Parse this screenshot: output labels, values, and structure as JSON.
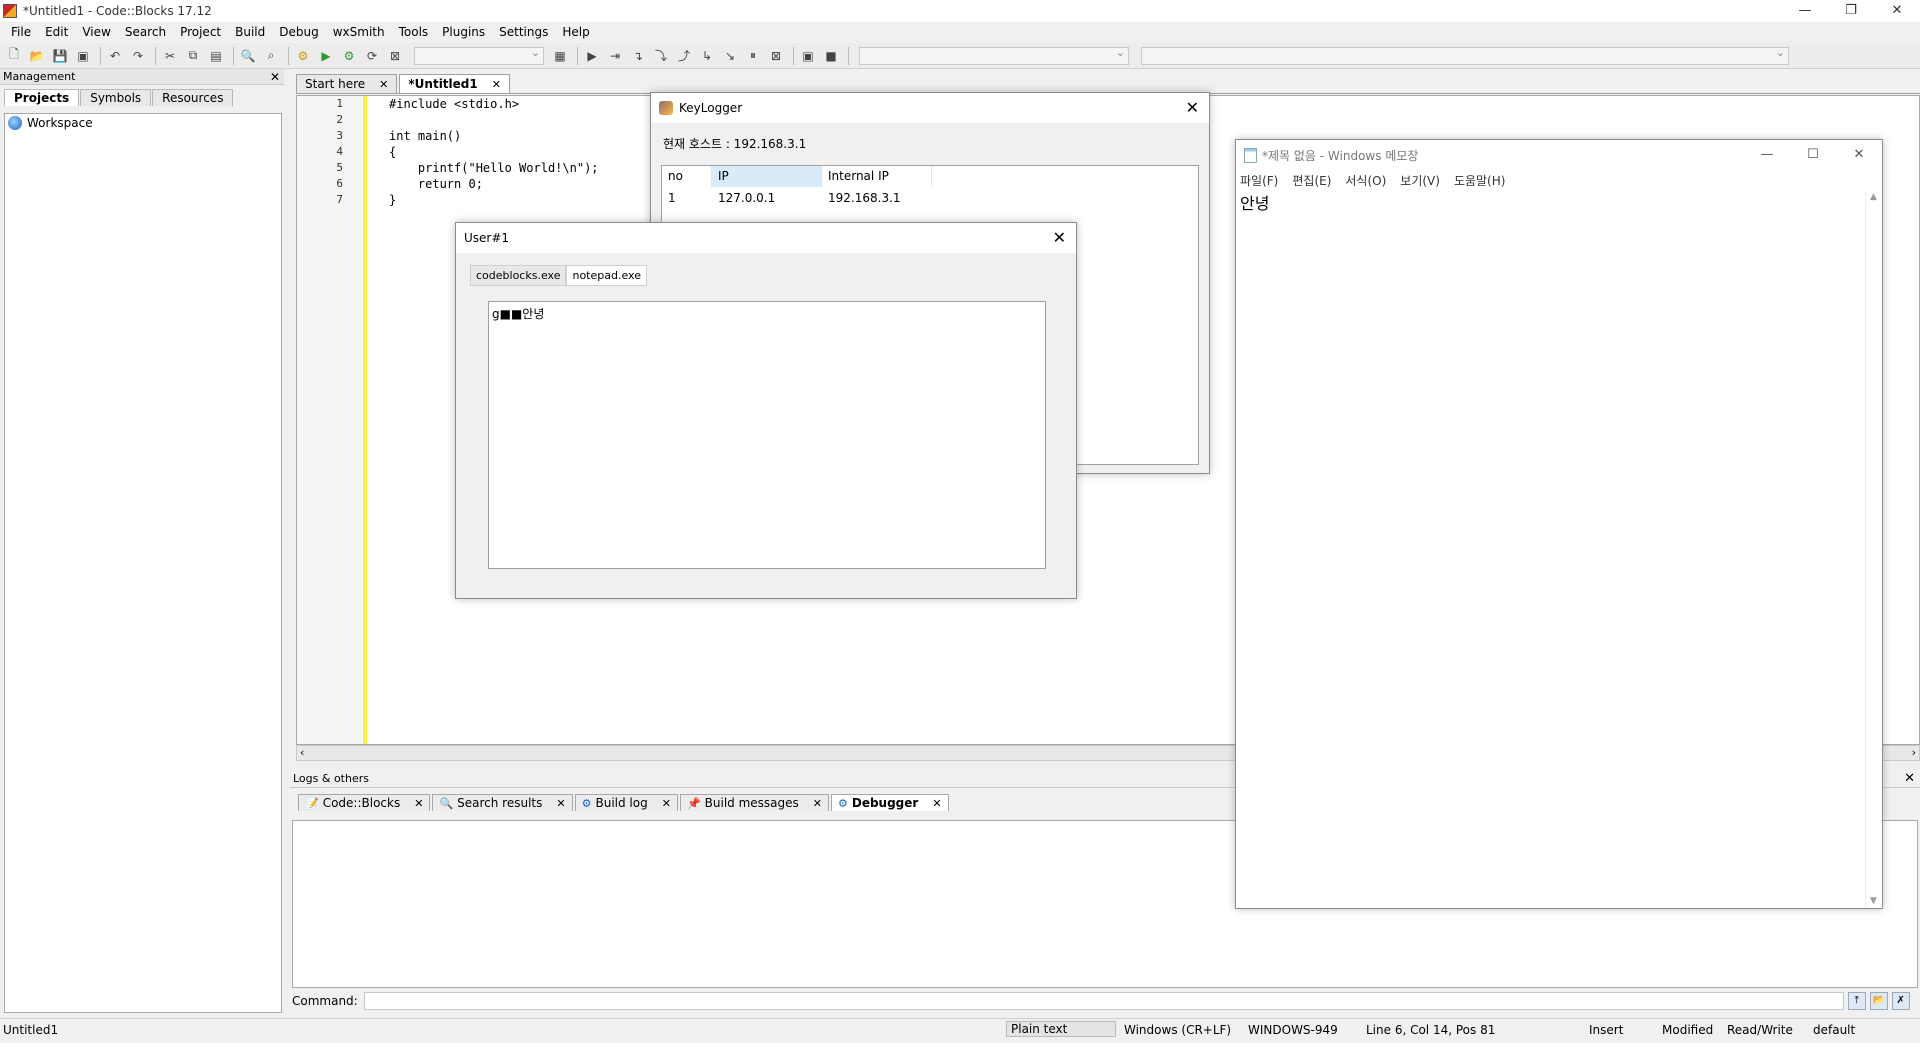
{
  "window": {
    "title": "*Untitled1 - Code::Blocks 17.12",
    "controls": [
      "—",
      "❐",
      "✕"
    ]
  },
  "menubar": [
    "File",
    "Edit",
    "View",
    "Search",
    "Project",
    "Build",
    "Debug",
    "wxSmith",
    "Tools",
    "Plugins",
    "Settings",
    "Help"
  ],
  "management": {
    "title": "Management",
    "tabs": [
      "Projects",
      "Symbols",
      "Resources"
    ],
    "workspace_label": "Workspace"
  },
  "editor": {
    "tabs": [
      "Start here",
      "*Untitled1"
    ],
    "line_numbers": [
      "1",
      "2",
      "3",
      "4",
      "5",
      "6",
      "7"
    ],
    "code_lines": [
      "#include <stdio.h>",
      "",
      "int main()",
      "{",
      "    printf(\"Hello World!\\n\");",
      "    return 0;",
      "}"
    ]
  },
  "logs": {
    "title": "Logs & others",
    "tabs": [
      "Code::Blocks",
      "Search results",
      "Build log",
      "Build messages",
      "Debugger"
    ],
    "command_label": "Command:"
  },
  "statusbar": {
    "file": "Untitled1",
    "mode": "Plain text",
    "eol": "Windows (CR+LF)",
    "encoding": "WINDOWS-949",
    "position": "Line 6, Col 14, Pos 81",
    "insert": "Insert",
    "modified": "Modified",
    "rw": "Read/Write",
    "profile": "default"
  },
  "keylogger": {
    "title": "KeyLogger",
    "host_label": "현재 호스트 : 192.168.3.1",
    "columns": [
      "no",
      "IP",
      "Internal IP"
    ],
    "rows": [
      {
        "no": "1",
        "ip": "127.0.0.1",
        "internal_ip": "192.168.3.1"
      }
    ]
  },
  "user_dialog": {
    "title": "User#1",
    "tabs": [
      "codeblocks.exe",
      "notepad.exe"
    ],
    "captured_text": "g■■안녕"
  },
  "notepad": {
    "title": "*제목 없음 - Windows 메모장",
    "menu": [
      "파일(F)",
      "편집(E)",
      "서식(O)",
      "보기(V)",
      "도움말(H)"
    ],
    "content": "안녕"
  },
  "colors": {
    "change_bar": "#ffef40",
    "list_header_selected": "#d9ebf9"
  }
}
